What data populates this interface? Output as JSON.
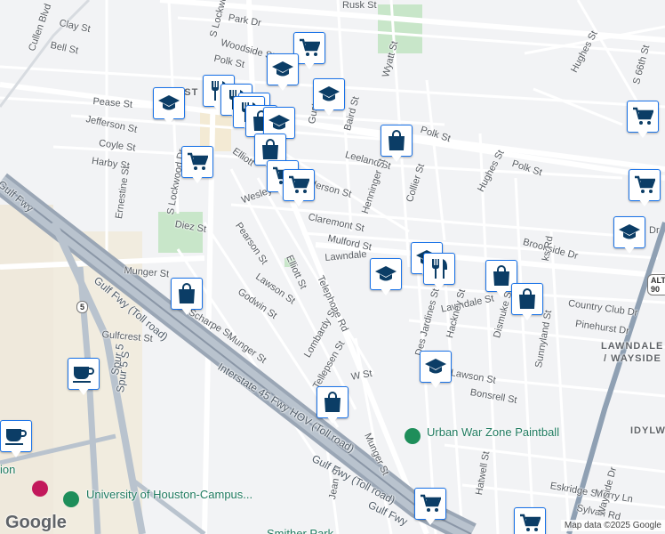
{
  "map": {
    "attribution": "Map data ©2025 Google",
    "logo": "Google",
    "street_labels": [
      {
        "text": "Cullen Blvd"
      },
      {
        "text": "Clay St"
      },
      {
        "text": "Bell St"
      },
      {
        "text": "Pease St"
      },
      {
        "text": "Jefferson St"
      },
      {
        "text": "Coyle St"
      },
      {
        "text": "Harby St"
      },
      {
        "text": "Ernestine St"
      },
      {
        "text": "S Lockwood Dr"
      },
      {
        "text": "S Lockwood Dr"
      },
      {
        "text": "Park Dr"
      },
      {
        "text": "Woodside St"
      },
      {
        "text": "Polk St"
      },
      {
        "text": "Rusk St"
      },
      {
        "text": "Wyatt St"
      },
      {
        "text": "Polk St"
      },
      {
        "text": "Baird St"
      },
      {
        "text": "Leeland St"
      },
      {
        "text": "Polk St"
      },
      {
        "text": "Hughes St"
      },
      {
        "text": "Hughes St"
      },
      {
        "text": "S 66th St"
      },
      {
        "text": "Gusta"
      },
      {
        "text": "Elliott"
      },
      {
        "text": "Wesley"
      },
      {
        "text": "Jefferson St"
      },
      {
        "text": "Henninger St"
      },
      {
        "text": "Collier St"
      },
      {
        "text": "Claremont St"
      },
      {
        "text": "Mulford St"
      },
      {
        "text": "Lawndale"
      },
      {
        "text": "Brookside Dr"
      },
      {
        "text": "Diez St"
      },
      {
        "text": "Pearson St"
      },
      {
        "text": "Elliott St"
      },
      {
        "text": "Munger St"
      },
      {
        "text": "Lawson St"
      },
      {
        "text": "Telephone Rd"
      },
      {
        "text": "Godwin St"
      },
      {
        "text": "Scharpe St"
      },
      {
        "text": "Munger St"
      },
      {
        "text": "Lombardy St"
      },
      {
        "text": "Gulfcrest St"
      },
      {
        "text": "Lawndale St"
      },
      {
        "text": "Country Club Dr"
      },
      {
        "text": "Pinehurst Dr"
      },
      {
        "text": "Des Jardines St"
      },
      {
        "text": "Hackney St"
      },
      {
        "text": "Dismuke St"
      },
      {
        "text": "Sunnyland St"
      },
      {
        "text": "Lawson St"
      },
      {
        "text": "Bonsrell St"
      },
      {
        "text": "Tellepsen St"
      },
      {
        "text": "W St"
      },
      {
        "text": "Munger St"
      },
      {
        "text": "Jean St"
      },
      {
        "text": "Hatwell St"
      },
      {
        "text": "Eskridge St"
      },
      {
        "text": "Merry Ln"
      },
      {
        "text": "Sylvan Rd"
      },
      {
        "text": "Wayside Dr"
      },
      {
        "text": "Spur 5"
      },
      {
        "text": "Spur 5 S"
      },
      {
        "text": "Gulf Fwy"
      },
      {
        "text": "Gulf Fwy (Toll road)"
      },
      {
        "text": "Interstate 45 Fwy HOV (Toll road)"
      },
      {
        "text": "Gulf Fwy (Toll road)"
      },
      {
        "text": "Gulf Fwy"
      },
      {
        "text": "ks Rd"
      },
      {
        "text": "Dr"
      }
    ],
    "area_labels": [
      {
        "text": "LAWNDALE"
      },
      {
        "text": "/ WAYSIDE"
      },
      {
        "text": "IDYLW"
      },
      {
        "text": "EAST"
      }
    ],
    "poi_labels": [
      {
        "text": "Urban War Zone Paintball"
      },
      {
        "text": "University of Houston-Campus..."
      },
      {
        "text": "Smither Park"
      },
      {
        "text": "ion"
      }
    ],
    "shields": [
      {
        "text": "5"
      },
      {
        "text": "ALT 90"
      }
    ],
    "markers": [
      {
        "icon": "shopping-cart-icon"
      },
      {
        "icon": "school-icon"
      },
      {
        "icon": "school-icon"
      },
      {
        "icon": "school-icon"
      },
      {
        "icon": "restaurant-icon"
      },
      {
        "icon": "restaurant-icon"
      },
      {
        "icon": "school-icon"
      },
      {
        "icon": "restaurant-icon"
      },
      {
        "icon": "shopping-bag-icon"
      },
      {
        "icon": "school-icon"
      },
      {
        "icon": "shopping-bag-icon"
      },
      {
        "icon": "shopping-cart-icon"
      },
      {
        "icon": "shopping-cart-icon"
      },
      {
        "icon": "shopping-cart-icon"
      },
      {
        "icon": "school-icon"
      },
      {
        "icon": "shopping-bag-icon"
      },
      {
        "icon": "school-icon"
      },
      {
        "icon": "restaurant-icon"
      },
      {
        "icon": "shopping-bag-icon"
      },
      {
        "icon": "shopping-bag-icon"
      },
      {
        "icon": "shopping-bag-icon"
      },
      {
        "icon": "cafe-icon"
      },
      {
        "icon": "cafe-icon"
      },
      {
        "icon": "shopping-bag-icon"
      },
      {
        "icon": "school-icon"
      },
      {
        "icon": "shopping-cart-icon"
      },
      {
        "icon": "shopping-cart-icon"
      }
    ],
    "colors": {
      "marker_fill": "#0b3d66",
      "marker_border": "#1a73e8",
      "park": "#c8e6c9",
      "freeway": "#9aa6b5",
      "road": "#ffffff"
    }
  }
}
